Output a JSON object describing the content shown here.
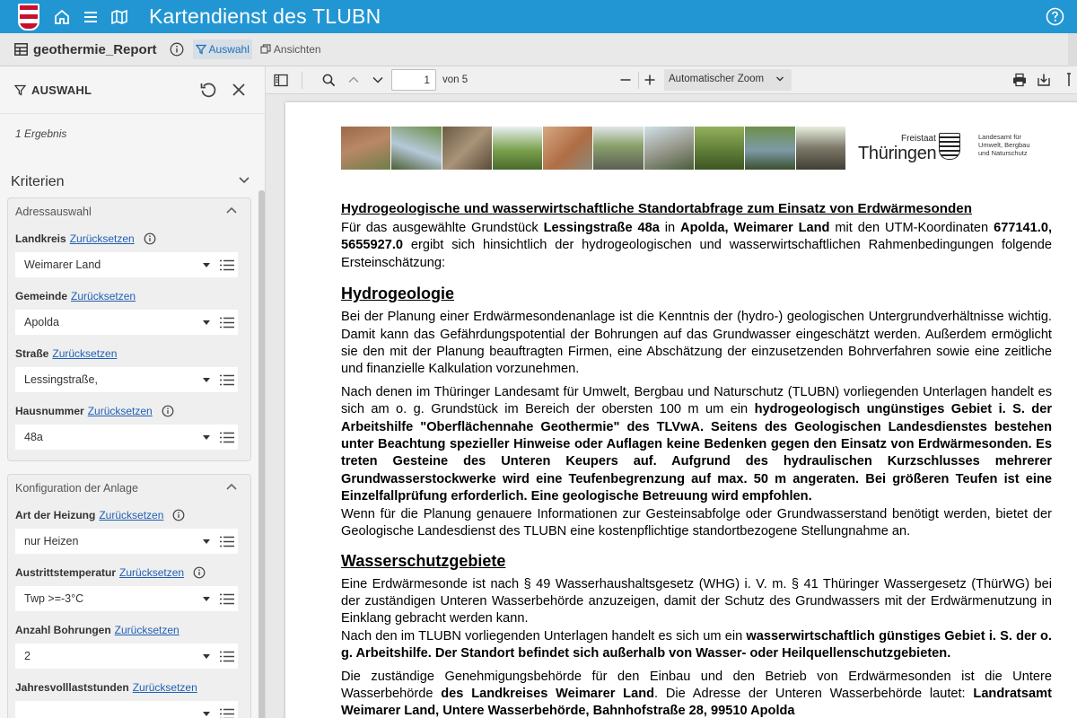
{
  "app": {
    "title": "Kartendienst des TLUBN"
  },
  "subbar": {
    "report_title": "geothermie_Report",
    "auswahl_label": "Auswahl",
    "ansichten_label": "Ansichten"
  },
  "sidebar": {
    "title": "AUSWAHL",
    "result_count": "1 Ergebnis",
    "criteria_label": "Kriterien",
    "sections": [
      {
        "title": "Adressauswahl",
        "fields": [
          {
            "label": "Landkreis",
            "reset": "Zurücksetzen",
            "value": "Weimarer Land"
          },
          {
            "label": "Gemeinde",
            "reset": "Zurücksetzen",
            "value": "Apolda"
          },
          {
            "label": "Straße",
            "reset": "Zurücksetzen",
            "value": "Lessingstraße,"
          },
          {
            "label": "Hausnummer",
            "reset": "Zurücksetzen",
            "value": "48a"
          }
        ]
      },
      {
        "title": "Konfiguration der Anlage",
        "fields": [
          {
            "label": "Art der Heizung",
            "reset": "Zurücksetzen",
            "value": "nur Heizen"
          },
          {
            "label": "Austrittstemperatur",
            "reset": "Zurücksetzen",
            "value": "Twp >=-3°C"
          },
          {
            "label": "Anzahl Bohrungen",
            "reset": "Zurücksetzen",
            "value": "2"
          },
          {
            "label": "Jahresvolllaststunden",
            "reset": "Zurücksetzen",
            "value": ""
          }
        ]
      }
    ]
  },
  "viewer": {
    "page_current": "1",
    "page_total_label": "von 5",
    "zoom_label": "Automatischer Zoom"
  },
  "logo": {
    "freistaat": "Freistaat",
    "land": "Thüringen",
    "amt_line1": "Landesamt für",
    "amt_line2": "Umwelt, Bergbau",
    "amt_line3": "und Naturschutz"
  },
  "document": {
    "title": "Hydrogeologische und wasserwirtschaftliche Standortabfrage zum Einsatz von Erdwärmesonden",
    "intro": {
      "a": "Für das ausgewählte Grundstück ",
      "address": "Lessingstraße 48a",
      "b": " in ",
      "place": "Apolda, Weimarer Land",
      "c": " mit den UTM-Koordinaten ",
      "coords": "677141.0, 5655927.0",
      "d": " ergibt sich hinsichtlich der hydrogeologischen und wasserwirtschaftlichen Rahmenbedingungen folgende Ersteinschätzung:"
    },
    "h_hydro": "Hydrogeologie",
    "hydro_p1": "Bei der Planung einer Erdwärmesondenanlage ist die Kenntnis der (hydro-) geologischen Untergrundverhältnisse wichtig. Damit kann das Gefährdungspotential der Bohrungen auf das Grundwasser eingeschätzt werden. Außerdem ermöglicht sie den mit der Planung beauftragten Firmen, eine Abschätzung der einzusetzenden Bohrverfahren sowie eine zeitliche und finanzielle Kalkulation vorzunehmen.",
    "hydro_p2_a": "Nach denen im Thüringer Landesamt für Umwelt, Bergbau und Naturschutz (TLUBN) vorliegenden Unterlagen handelt es sich am o. g. Grundstück im Bereich der obersten 100 m um ein ",
    "hydro_p2_b": "hydrogeologisch ungünstiges Gebiet i. S. der Arbeitshilfe \"Oberflächennahe Geothermie\" des TLVwA. Seitens des Geologischen Landesdienstes bestehen unter Beachtung spezieller Hinweise oder Auflagen keine Bedenken gegen den Einsatz von Erdwärmesonden. Es treten Gesteine des Unteren Keupers auf. Aufgrund des hydraulischen Kurzschlusses mehrerer Grundwasserstockwerke wird eine Teufenbegrenzung auf max. 50 m angeraten. Bei größeren Teufen ist eine Einzelfallprüfung erforderlich. Eine geologische Betreuung wird empfohlen.",
    "hydro_p3": "Wenn für die Planung genauere Informationen zur Gesteinsabfolge oder Grundwasserstand benötigt werden, bietet der Geologische Landesdienst des TLUBN eine kostenpflichtige standortbezogene Stellungnahme an.",
    "h_wasser": "Wasserschutzgebiete",
    "wasser_p1": "Eine Erdwärmesonde ist nach § 49 Wasserhaushaltsgesetz (WHG) i. V. m. § 41 Thüringer Wassergesetz (ThürWG) bei der zuständigen Unteren Wasserbehörde anzuzeigen, damit der Schutz des Grundwassers mit der Erdwärmenutzung in Einklang gebracht werden kann.",
    "wasser_p2_a": "Nach den im TLUBN vorliegenden Unterlagen handelt es sich um ein ",
    "wasser_p2_b": "wasserwirtschaftlich günstiges Gebiet i. S. der o. g. Arbeitshilfe. Der Standort befindet sich außerhalb von Wasser- oder Heilquellenschutzgebieten.",
    "wasser_p3_a": "Die zuständige Genehmigungsbehörde für den Einbau und den Betrieb von Erdwärmesonden ist die Untere Wasserbehörde ",
    "wasser_p3_b": "des Landkreises Weimarer Land",
    "wasser_p3_c": ". Die Adresse der Unteren Wasserbehörde lautet: ",
    "wasser_p3_d": "Landratsamt Weimarer Land, Untere Wasserbehörde, Bahnhofstraße 28, 99510 Apolda"
  }
}
